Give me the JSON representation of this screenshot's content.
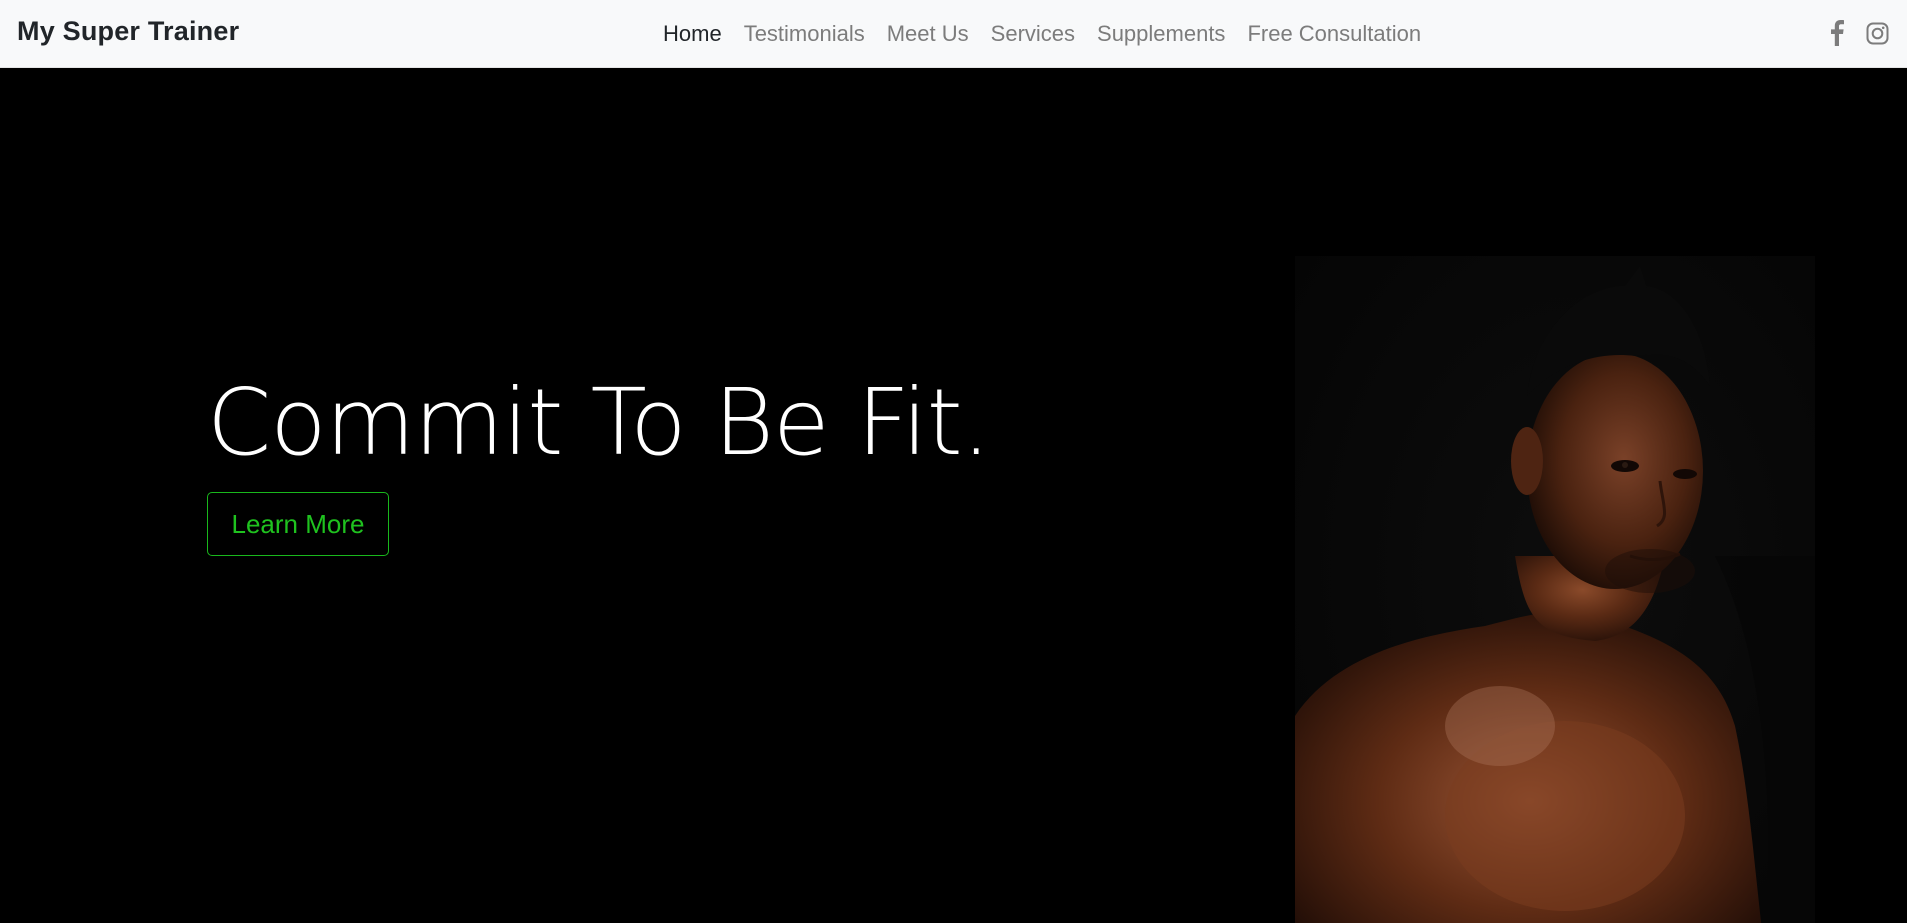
{
  "navbar": {
    "brand": "My Super Trainer",
    "links": [
      {
        "label": "Home",
        "active": true
      },
      {
        "label": "Testimonials",
        "active": false
      },
      {
        "label": "Meet Us",
        "active": false
      },
      {
        "label": "Services",
        "active": false
      },
      {
        "label": "Supplements",
        "active": false
      },
      {
        "label": "Free Consultation",
        "active": false
      }
    ],
    "social_icons": [
      "facebook-icon",
      "instagram-icon"
    ]
  },
  "hero": {
    "headline": "Commit To Be Fit.",
    "button_label": "Learn More",
    "accent_color": "#1fc21f"
  }
}
